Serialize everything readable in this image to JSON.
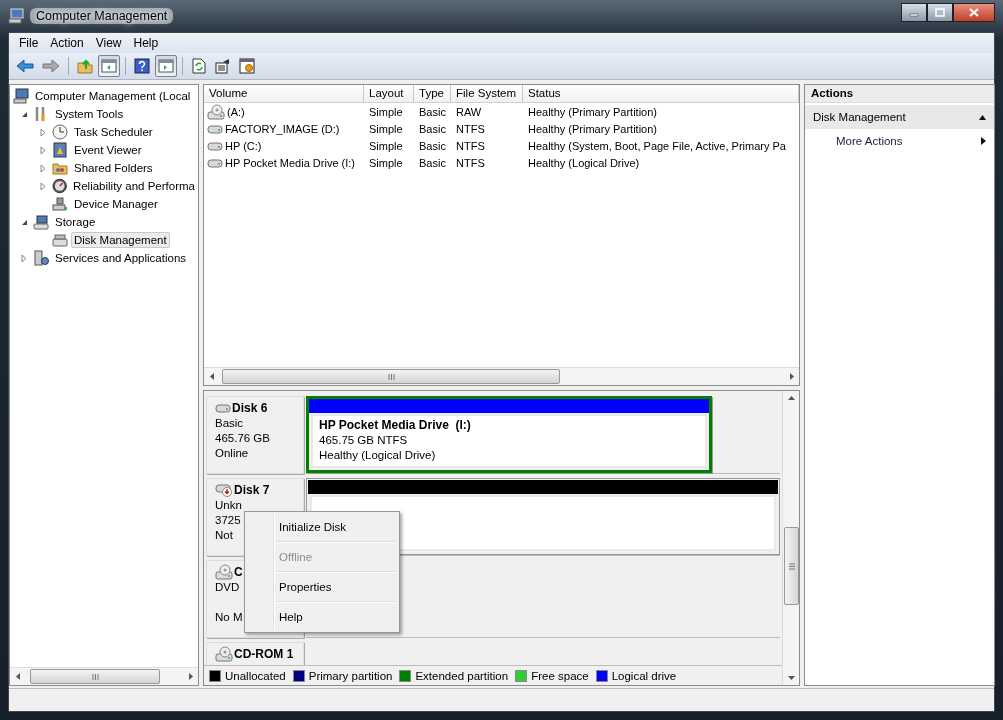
{
  "window": {
    "title": "Computer Management"
  },
  "menu": [
    "File",
    "Action",
    "View",
    "Help"
  ],
  "toolbar": [
    {
      "kind": "back",
      "pressed": false
    },
    {
      "kind": "forward",
      "pressed": false
    },
    {
      "kind": "sep"
    },
    {
      "kind": "up",
      "pressed": false
    },
    {
      "kind": "tree",
      "pressed": true
    },
    {
      "kind": "sep"
    },
    {
      "kind": "help",
      "pressed": false
    },
    {
      "kind": "actionpane",
      "pressed": true
    },
    {
      "kind": "sep"
    },
    {
      "kind": "refresh",
      "pressed": false
    },
    {
      "kind": "export",
      "pressed": false
    },
    {
      "kind": "properties",
      "pressed": false
    }
  ],
  "tree": [
    {
      "label": "Computer Management (Local",
      "selected": false,
      "children": [
        {
          "label": "System Tools",
          "expanded": true,
          "selected": false,
          "children": [
            {
              "label": "Task Scheduler",
              "expanded": false,
              "selected": false
            },
            {
              "label": "Event Viewer",
              "expanded": false,
              "selected": false
            },
            {
              "label": "Shared Folders",
              "expanded": false,
              "selected": false
            },
            {
              "label": "Reliability and Performa",
              "expanded": false,
              "selected": false
            },
            {
              "label": "Device Manager",
              "selected": false
            }
          ]
        },
        {
          "label": "Storage",
          "expanded": true,
          "selected": false,
          "children": [
            {
              "label": "Disk Management",
              "selected": true
            }
          ]
        },
        {
          "label": "Services and Applications",
          "expanded": false,
          "selected": false
        }
      ]
    }
  ],
  "volumes": {
    "columns": [
      "Volume",
      "Layout",
      "Type",
      "File System",
      "Status"
    ],
    "rows": [
      {
        "kind": "optical",
        "cells": [
          "(A:)",
          "Simple",
          "Basic",
          "RAW",
          "Healthy (Primary Partition)"
        ]
      },
      {
        "kind": "disk",
        "cells": [
          "FACTORY_IMAGE (D:)",
          "Simple",
          "Basic",
          "NTFS",
          "Healthy (Primary Partition)"
        ]
      },
      {
        "kind": "disk",
        "cells": [
          "HP (C:)",
          "Simple",
          "Basic",
          "NTFS",
          "Healthy (System, Boot, Page File, Active, Primary Pa"
        ]
      },
      {
        "kind": "disk",
        "cells": [
          "HP Pocket Media Drive (I:)",
          "Simple",
          "Basic",
          "NTFS",
          "Healthy (Logical Drive)"
        ]
      }
    ]
  },
  "disks": [
    {
      "kind": "disk",
      "name": "Disk 6",
      "type": "Basic",
      "size": "465.76 GB",
      "state": "Online",
      "partitions": [
        {
          "color": "#0000ff",
          "extended": true,
          "title": "HP Pocket Media Drive  (I:)",
          "lines": [
            "465.75 GB NTFS",
            "Healthy (Logical Drive)"
          ]
        }
      ]
    },
    {
      "kind": "unknown",
      "name": "Disk 7",
      "type": "Unkn",
      "size": "3725",
      "state": "Not",
      "partitions": [
        {
          "color": "#000000",
          "extended": false
        }
      ]
    },
    {
      "kind": "optical",
      "name": "C",
      "type": "DVD",
      "state": "No M"
    },
    {
      "kind": "optical",
      "name": "CD-ROM 1"
    }
  ],
  "legend": [
    {
      "label": "Unallocated",
      "color": "#000000"
    },
    {
      "label": "Primary partition",
      "color": "#000080"
    },
    {
      "label": "Extended partition",
      "color": "#008000"
    },
    {
      "label": "Free space",
      "color": "#33cc33"
    },
    {
      "label": "Logical drive",
      "color": "#0000ff"
    }
  ],
  "context_menu": [
    {
      "label": "Initialize Disk",
      "disabled": false
    },
    {
      "label": "Offline",
      "disabled": true
    },
    {
      "label": "Properties",
      "disabled": false
    },
    {
      "label": "Help",
      "disabled": false
    }
  ],
  "actions": {
    "title": "Actions",
    "section": "Disk Management",
    "items": [
      "More Actions"
    ]
  }
}
